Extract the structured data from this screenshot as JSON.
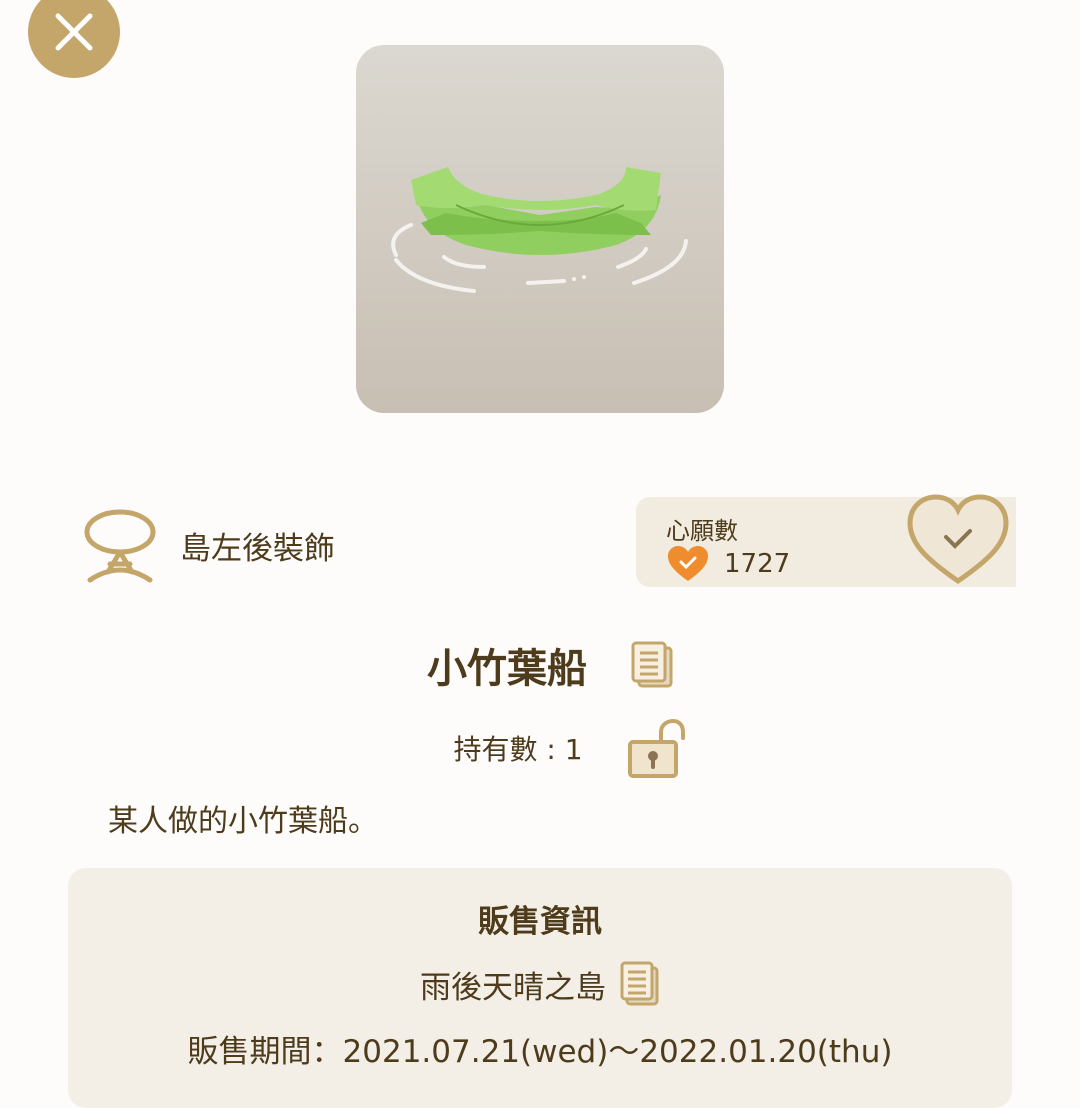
{
  "header": {
    "close_icon": "close-icon"
  },
  "item": {
    "image_icon": "bamboo-leaf-boat",
    "category_icon": "island-decoration-icon",
    "category": "島左後裝飾",
    "name": "小竹葉船",
    "owned": "持有數 : 1",
    "description": "某人做的小竹葉船。"
  },
  "wish": {
    "title": "心願數",
    "count": "1727",
    "heart_color": "#ef8c2e"
  },
  "sale": {
    "title": "販售資訊",
    "location": "雨後天晴之島",
    "period": "販售期間：2021.07.21(wed)～2022.01.20(thu)"
  },
  "colors": {
    "accent": "#c4a66b",
    "text": "#4d3b1c",
    "panel": "#f4efe6"
  }
}
